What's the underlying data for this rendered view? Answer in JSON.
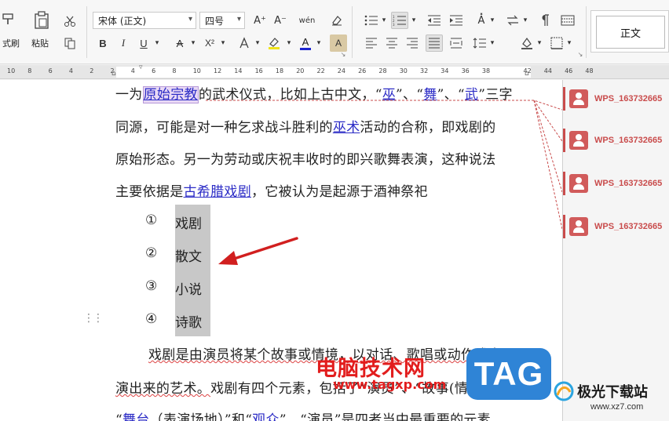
{
  "ribbon": {
    "format_painter_label": "式刷",
    "paste_label": "粘贴",
    "font_name": "宋体 (正文)",
    "font_size": "四号",
    "style_normal": "正文",
    "bold": "B",
    "italic": "I",
    "underline": "U",
    "strike": "A",
    "superscript": "X²",
    "grow_font": "A⁺",
    "shrink_font": "A⁻",
    "pinyin": "wén",
    "font_color": "A",
    "highlight": "ab",
    "char_shading": "A"
  },
  "ruler": {
    "ticks": [
      "10",
      "8",
      "6",
      "4",
      "2",
      "2",
      "4",
      "6",
      "8",
      "10",
      "12",
      "14",
      "16",
      "18",
      "20",
      "22",
      "24",
      "26",
      "28",
      "30",
      "32",
      "34",
      "36",
      "38",
      "",
      "42",
      "44",
      "46",
      "48"
    ]
  },
  "document": {
    "line1": {
      "a": "一为",
      "b": "原始宗教",
      "c": "的武术仪式，比如上古中文，“",
      "d": "巫",
      "e": "”、“",
      "f": "舞",
      "g": "”、“",
      "h": "武",
      "i": "”三字"
    },
    "line2": {
      "a": "同源，可能是对一种乞求战斗胜利的",
      "b": "巫术",
      "c": "活动的合称，即戏剧的"
    },
    "line3": "原始形态。另一为劳动或庆祝丰收时的即兴歌舞表演，这种说法",
    "line4": {
      "a": "主要依据是",
      "b": "古希腊戏剧",
      "c": "，它被认为是起源于酒神祭祀"
    },
    "list": [
      {
        "num": "①",
        "text": "戏剧"
      },
      {
        "num": "②",
        "text": "散文"
      },
      {
        "num": "③",
        "text": "小说"
      },
      {
        "num": "④",
        "text": "诗歌"
      }
    ],
    "line5": "戏剧是由演员将某个故事或情境，以对话、歌唱或动作式表",
    "line6": {
      "a": "演出来的艺术。",
      "b": "戏剧有四个元素，包括了“演员”、“故事(情境)”、"
    },
    "line7": {
      "a": "“",
      "b": "舞台",
      "c": "（表演场地）”和“",
      "d": "观众",
      "e": "”。“演员”是四者当中最重要的元素，"
    }
  },
  "comments": [
    {
      "author": "WPS_163732665"
    },
    {
      "author": "WPS_163732665"
    },
    {
      "author": "WPS_163732665"
    },
    {
      "author": "WPS_163732665"
    }
  ],
  "watermark": {
    "site_title": "电脑技术网",
    "site_url": "www.tagxp.com",
    "tag_logo": "TAG",
    "site2_title": "极光下载站",
    "site2_url": "www.xz7.com"
  },
  "colors": {
    "comment_accent": "#c94c4c",
    "link": "#2c2cc6",
    "arrow": "#d11f1f",
    "tag_blue": "#2f84d6"
  }
}
